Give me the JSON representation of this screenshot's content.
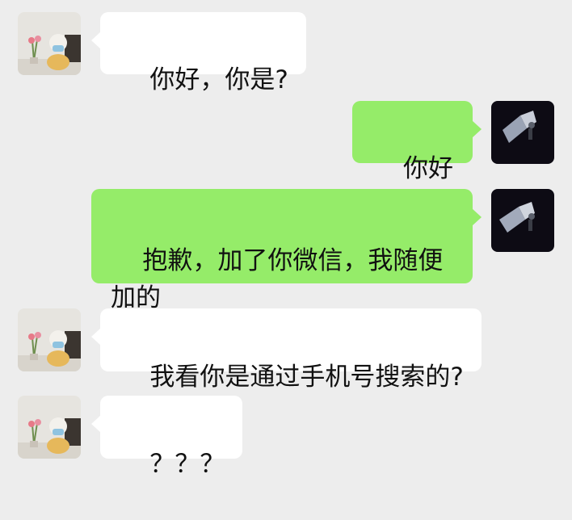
{
  "chat": {
    "messages": [
      {
        "sender": "contact",
        "text": "你好，你是?"
      },
      {
        "sender": "me",
        "text": "你好"
      },
      {
        "sender": "me",
        "text": "抱歉，加了你微信，我随便加的"
      },
      {
        "sender": "contact",
        "text": "我看你是通过手机号搜索的?"
      },
      {
        "sender": "contact",
        "text": "？？？"
      }
    ]
  },
  "colors": {
    "background": "#ededed",
    "incoming_bubble": "#ffffff",
    "outgoing_bubble": "#95ec69",
    "text": "#111111"
  },
  "icons": {
    "contact_avatar": "doll-with-flowers-avatar",
    "my_avatar": "dark-photo-avatar"
  }
}
